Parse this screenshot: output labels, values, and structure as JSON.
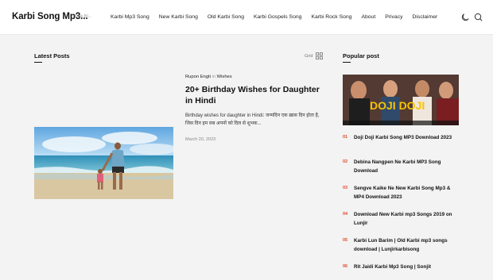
{
  "stray_glyph": "->",
  "header": {
    "brand": "Karbi Song Mp3...",
    "tagline": "This Bl...",
    "nav": [
      "Karbi Mp3 Song",
      "New Karbi Song",
      "Old Karbi Song",
      "Karbi Gospels Song",
      "Karbi Rock Song",
      "About",
      "Privacy",
      "Disclaimer"
    ],
    "icons": [
      "moon-icon",
      "search-icon"
    ]
  },
  "latest": {
    "title": "Latest Posts",
    "view_label": "Grid"
  },
  "post": {
    "author": "Rupon Engti",
    "in_word": "in",
    "category": "Wishes",
    "title": "20+ Birthday Wishes for Daughter in Hindi",
    "excerpt": "Birthday wishes for daughter in Hindi: जन्मदिन एक ख़ास दिन होता है, जिस दिन हम सब अपनों को दिल से शुभक...",
    "date": "March 20, 2023"
  },
  "popular": {
    "title": "Popular post",
    "items": [
      {
        "num": "01",
        "title": "Doji Doji Karbi Song MP3 Download 2023"
      },
      {
        "num": "02",
        "title": "Debina Nangpen Ne Karbi MP3 Song Download"
      },
      {
        "num": "03",
        "title": "Sengve Kaike Ne New Karbi Song Mp3 & MP4 Download 2023"
      },
      {
        "num": "04",
        "title": "Download New Karbi mp3 Songs 2019 on Lunjir"
      },
      {
        "num": "05",
        "title": "Karbi Lun Barim | Old Karbi mp3 songs download | Lunjirkarbisong"
      },
      {
        "num": "06",
        "title": "Rit Jaidi Karbi Mp3 Song | Sonjit"
      }
    ],
    "image_text": "DOJI DOJI"
  },
  "colors": {
    "accent": "#e0492b",
    "background": "#f3f3f3"
  }
}
